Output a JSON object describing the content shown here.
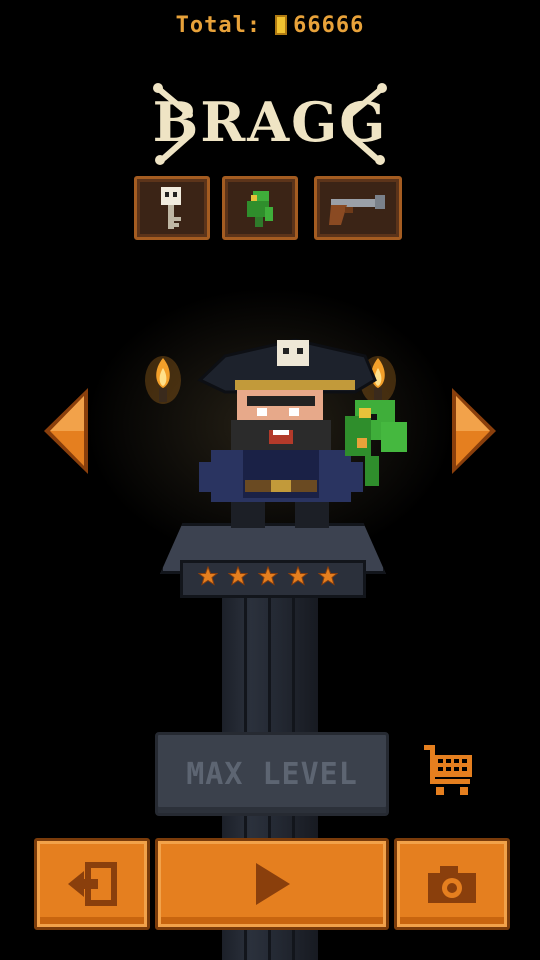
{
  "header": {
    "total_label": "Total:",
    "total_value": "66666"
  },
  "character": {
    "name": "BRAGG",
    "stars_filled": 5,
    "stars_total": 5
  },
  "items": [
    {
      "icon": "skull-key-icon"
    },
    {
      "icon": "parrot-icon"
    },
    {
      "icon": "flintlock-pistol-icon"
    }
  ],
  "actions": {
    "max_level_label": "MAX LEVEL",
    "cart_icon": "shopping-cart-icon",
    "exit_icon": "exit-icon",
    "play_icon": "play-icon",
    "camera_icon": "camera-icon"
  },
  "colors": {
    "accent_orange": "#e57f1f",
    "coin_gold": "#f2c230",
    "title_bone": "#efe4c4",
    "disabled_gray": "#3b414c"
  }
}
